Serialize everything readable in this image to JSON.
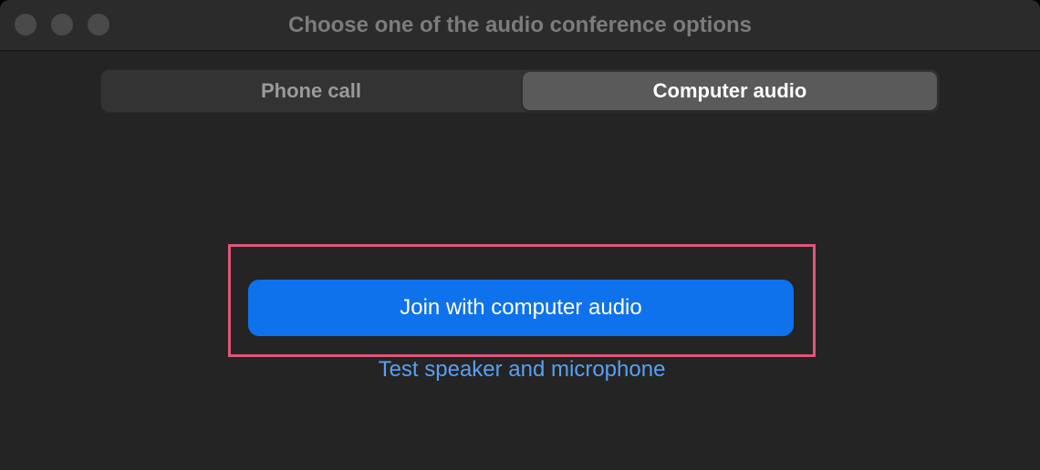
{
  "window": {
    "title": "Choose one of the audio conference options"
  },
  "tabs": [
    {
      "label": "Phone call",
      "selected": false
    },
    {
      "label": "Computer audio",
      "selected": true
    }
  ],
  "main": {
    "join_button_label": "Join with computer audio",
    "test_link_label": "Test speaker and microphone"
  },
  "colors": {
    "window_background": "#242424",
    "titlebar_background": "#2b2b2b",
    "selected_tab": "#5a5a5a",
    "primary_button": "#0e72ed",
    "link": "#5a9ff0",
    "highlight_border": "#e0567a"
  },
  "icons": {
    "close": "close-traffic-light-icon",
    "minimize": "minimize-traffic-light-icon",
    "zoom": "zoom-traffic-light-icon"
  }
}
